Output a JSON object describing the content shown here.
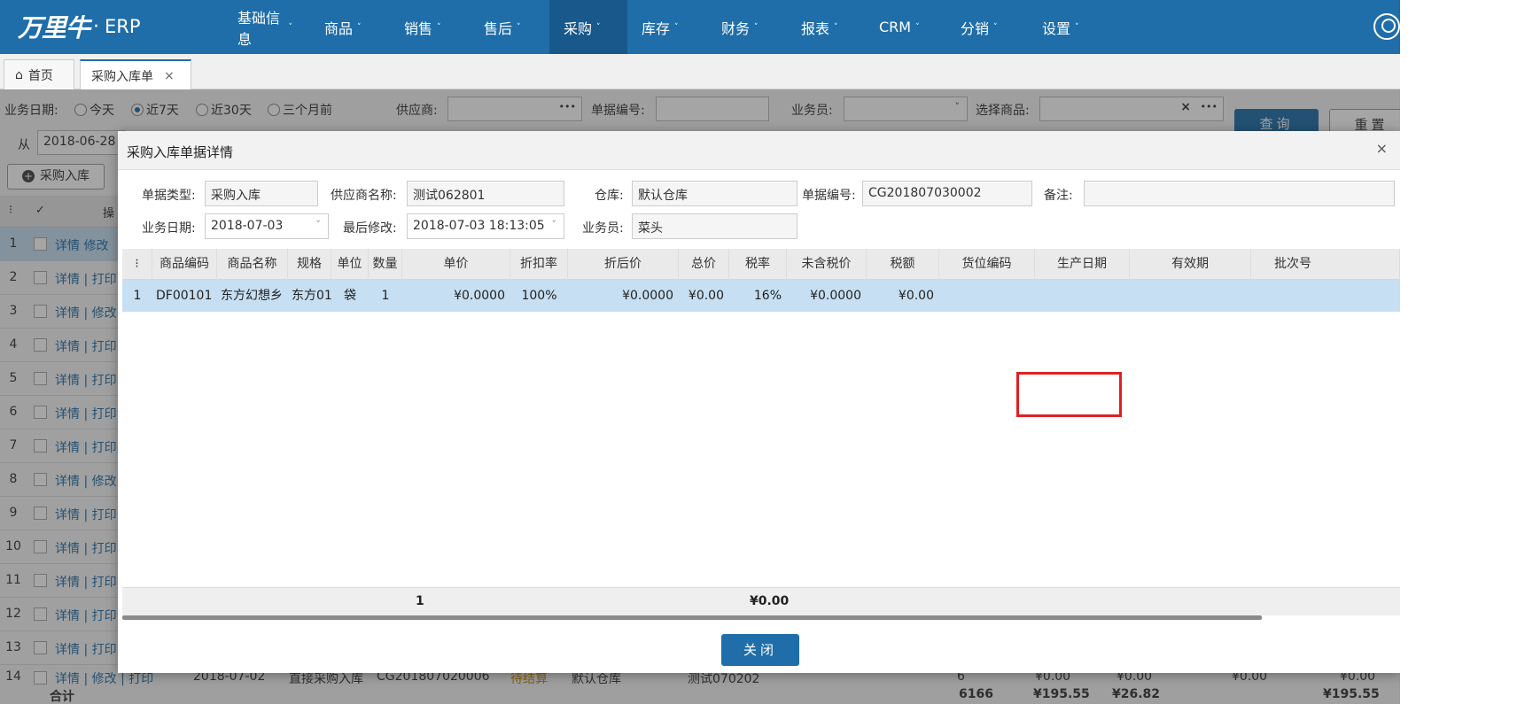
{
  "brand": {
    "mark": "万里牛",
    "dot": "·",
    "name": "ERP"
  },
  "nav": [
    {
      "label": "基础信息",
      "caret": "˅"
    },
    {
      "label": "商品",
      "caret": "˅"
    },
    {
      "label": "销售",
      "caret": "˅"
    },
    {
      "label": "售后",
      "caret": "˅"
    },
    {
      "label": "采购",
      "caret": "˅"
    },
    {
      "label": "库存",
      "caret": "˅"
    },
    {
      "label": "财务",
      "caret": "˅"
    },
    {
      "label": "报表",
      "caret": "˅"
    },
    {
      "label": "CRM",
      "caret": "˅"
    },
    {
      "label": "分销",
      "caret": "˅"
    },
    {
      "label": "设置",
      "caret": "˅"
    }
  ],
  "tabs": {
    "home": "首页",
    "active": "采购入库单",
    "home_icon": "⌂",
    "close_icon": "×"
  },
  "filters": {
    "date_label": "业务日期:",
    "today": "今天",
    "last7": "近7天",
    "last30": "近30天",
    "last3m": "三个月前",
    "supplier_label": "供应商:",
    "order_no_label": "单据编号:",
    "staff_label": "业务员:",
    "product_label": "选择商品:",
    "from_label": "从",
    "from_value": "2018-06-28",
    "query_btn": "查询",
    "reset_btn": "重置",
    "ellipsis": "•••",
    "clear": "×",
    "dropdown_caret": "˅"
  },
  "toolbar": {
    "purchase_in_btn": "采购入库",
    "plus_icon": "+"
  },
  "list_header": {
    "menu": "⁝",
    "check": "✓",
    "op": "操"
  },
  "list_rows": [
    {
      "num": "1",
      "links": "详情  修改"
    },
    {
      "num": "2",
      "links": "详情 | 打印"
    },
    {
      "num": "3",
      "links": "详情 | 修改"
    },
    {
      "num": "4",
      "links": "详情 | 打印"
    },
    {
      "num": "5",
      "links": "详情 | 打印"
    },
    {
      "num": "6",
      "links": "详情 | 打印"
    },
    {
      "num": "7",
      "links": "详情 | 打印"
    },
    {
      "num": "8",
      "links": "详情 | 修改"
    },
    {
      "num": "9",
      "links": "详情 | 打印"
    },
    {
      "num": "10",
      "links": "详情 | 打印"
    },
    {
      "num": "11",
      "links": "详情 | 打印"
    },
    {
      "num": "12",
      "links": "详情 | 打印"
    },
    {
      "num": "13",
      "links": "详情 | 打印"
    }
  ],
  "list_row14": {
    "num": "14",
    "links": "详情 | 修改 | 打印",
    "date": "2018-07-02",
    "type": "直接采购入库",
    "order_no": "CG201807020006",
    "status": "待结算",
    "warehouse": "默认仓库",
    "supplier": "测试070202",
    "qty": "6",
    "v1": "¥0.00",
    "v2": "¥0.00",
    "v3": "¥0.00",
    "v4": "¥0.00"
  },
  "list_total": {
    "label": "合计",
    "qty": "6166",
    "amount": "¥195.55",
    "tax": "¥26.82",
    "total": "¥195.55"
  },
  "dialog": {
    "title": "采购入库单据详情",
    "close_icon": "×",
    "fields": {
      "type_label": "单据类型:",
      "type_value": "采购入库",
      "supplier_label": "供应商名称:",
      "supplier_value": "测试062801",
      "warehouse_label": "仓库:",
      "warehouse_value": "默认仓库",
      "order_label": "单据编号:",
      "order_value": "CG201807030002",
      "remark_label": "备注:",
      "remark_value": "",
      "bizdate_label": "业务日期:",
      "bizdate_value": "2018-07-03",
      "modified_label": "最后修改:",
      "modified_value": "2018-07-03 18:13:05",
      "staff_label": "业务员:",
      "staff_value": "菜头",
      "chevron": "˅"
    },
    "columns": [
      "⁝",
      "商品编码",
      "商品名称",
      "规格",
      "单位",
      "数量",
      "单价",
      "折扣率",
      "折后价",
      "总价",
      "税率",
      "未含税价",
      "税额",
      "货位编码",
      "生产日期",
      "有效期",
      "批次号"
    ],
    "rows": [
      {
        "num": "1",
        "code": "DF00101",
        "name": "东方幻想乡",
        "spec": "东方01",
        "unit": "袋",
        "qty": "1",
        "price": "¥0.0000",
        "discount": "100%",
        "disc_price": "¥0.0000",
        "total": "¥0.00",
        "tax_rate": "16%",
        "pretax": "¥0.0000",
        "tax": "¥0.00",
        "location": "",
        "prod_date": "",
        "expiry": "",
        "batch": ""
      }
    ],
    "footer": {
      "qty_sum": "1",
      "total_sum": "¥0.00"
    },
    "close_btn": "关闭"
  }
}
